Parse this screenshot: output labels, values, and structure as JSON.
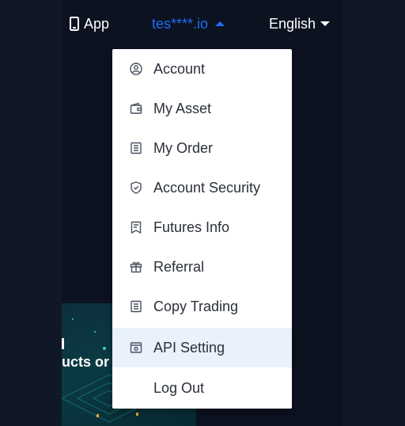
{
  "topbar": {
    "app_label": "App",
    "user_label": "tes****.io",
    "language_label": "English"
  },
  "banner": {
    "text": "ucts or"
  },
  "menu": {
    "items": [
      {
        "label": "Account",
        "icon": "user-circle-icon"
      },
      {
        "label": "My Asset",
        "icon": "wallet-icon"
      },
      {
        "label": "My Order",
        "icon": "order-list-icon"
      },
      {
        "label": "Account Security",
        "icon": "shield-icon"
      },
      {
        "label": "Futures Info",
        "icon": "bookmark-icon"
      },
      {
        "label": "Referral",
        "icon": "gift-icon"
      },
      {
        "label": "Copy Trading",
        "icon": "copy-list-icon"
      },
      {
        "label": "API Setting",
        "icon": "api-window-icon",
        "active": true
      },
      {
        "label": "Log Out"
      }
    ]
  },
  "colors": {
    "accent": "#1e6ff5",
    "menu_active_bg": "#e8f1fc",
    "background": "#0c1220"
  }
}
